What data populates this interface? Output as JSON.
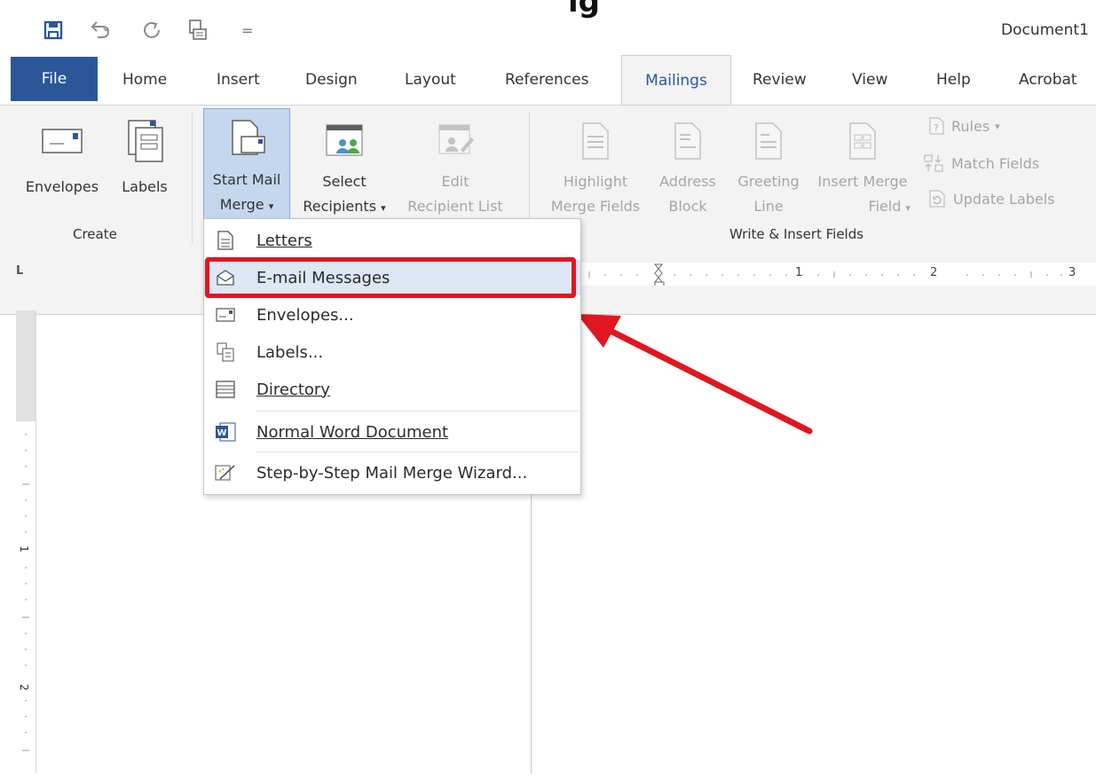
{
  "window": {
    "document_title": "Document1",
    "title_glyph": "ig"
  },
  "quick_access": {
    "customize_glyph": "="
  },
  "tabs": [
    {
      "label": "File"
    },
    {
      "label": "Home"
    },
    {
      "label": "Insert"
    },
    {
      "label": "Design"
    },
    {
      "label": "Layout"
    },
    {
      "label": "References"
    },
    {
      "label": "Mailings"
    },
    {
      "label": "Review"
    },
    {
      "label": "View"
    },
    {
      "label": "Help"
    },
    {
      "label": "Acrobat"
    }
  ],
  "ribbon": {
    "create": {
      "label": "Create",
      "envelopes": "Envelopes",
      "labels": "Labels"
    },
    "start_mail_merge": {
      "start_mail_line1": "Start Mail",
      "start_mail_line2": "Merge",
      "select_line1": "Select",
      "select_line2": "Recipients",
      "edit_line1": "Edit",
      "edit_line2": "Recipient List"
    },
    "write_insert": {
      "label": "Write & Insert Fields",
      "highlight_line1": "Highlight",
      "highlight_line2": "Merge Fields",
      "address_line1": "Address",
      "address_line2": "Block",
      "greeting_line1": "Greeting",
      "greeting_line2": "Line",
      "insert_line1": "Insert Merge",
      "insert_line2": "Field",
      "rules": "Rules",
      "match_fields": "Match Fields",
      "update_labels": "Update Labels"
    },
    "dropdown_glyph": "▾"
  },
  "ruler": {
    "tab_selector": "L",
    "marks": [
      "1",
      "2",
      "3"
    ],
    "vmarks": [
      "1",
      "2"
    ]
  },
  "dropdown_menu": {
    "items": [
      {
        "label": "Letters",
        "icon": "letter-icon"
      },
      {
        "label": "E-mail Messages",
        "icon": "email-icon",
        "highlighted": true
      },
      {
        "label": "Envelopes...",
        "icon": "envelope-icon"
      },
      {
        "label": "Labels...",
        "icon": "labels-icon"
      },
      {
        "label": "Directory",
        "icon": "directory-icon"
      },
      {
        "label": "Normal Word Document",
        "icon": "word-icon"
      },
      {
        "label": "Step-by-Step Mail Merge Wizard...",
        "icon": "wizard-icon"
      }
    ]
  },
  "annotation": {
    "color": "#e11620"
  },
  "colors": {
    "brand_blue": "#2b579a",
    "ribbon_bg": "#f3f3f3",
    "highlight": "#dde7f5"
  }
}
